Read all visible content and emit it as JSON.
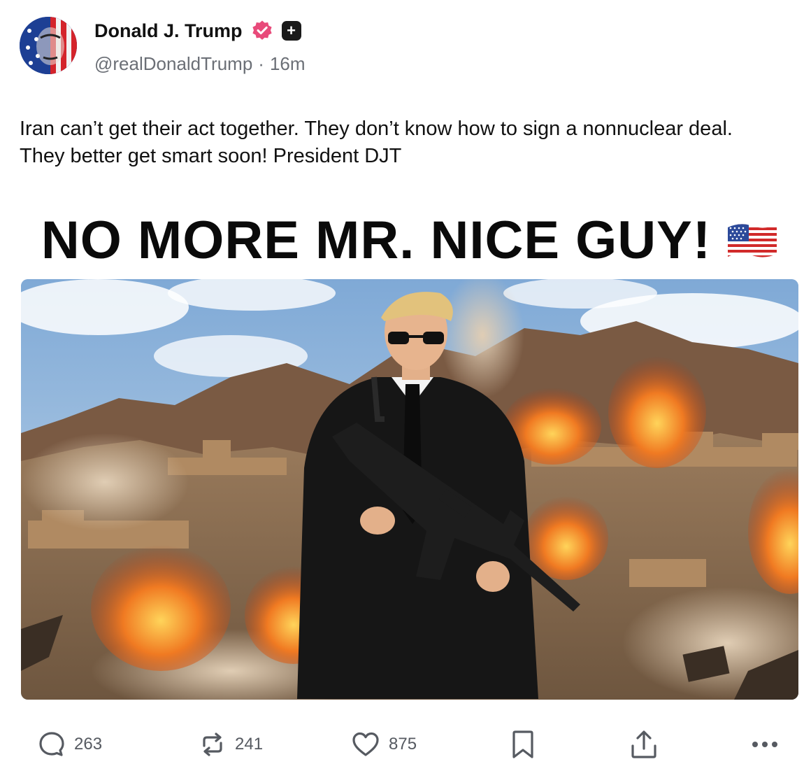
{
  "post": {
    "author_name": "Donald J. Trump",
    "handle": "@realDonaldTrump",
    "separator": "·",
    "time_ago": "16m",
    "text": "Iran can’t get their act together. They don’t know how to sign a nonnuclear deal. They better get smart soon! President DJT"
  },
  "media": {
    "banner_text": "NO MORE MR. NICE GUY!",
    "banner_emoji": "us-flag-emoji"
  },
  "actions": {
    "replies": "263",
    "reposts": "241",
    "likes": "875"
  },
  "icons": {
    "verified": "verified-badge-icon",
    "plus": "plus-badge-icon",
    "reply": "comment-icon",
    "repost": "repost-icon",
    "like": "heart-icon",
    "bookmark": "bookmark-icon",
    "share": "share-icon",
    "more": "more-icon"
  },
  "colors": {
    "verified_pink": "#e84a7a",
    "text": "#111111",
    "muted": "#6b6f76"
  }
}
